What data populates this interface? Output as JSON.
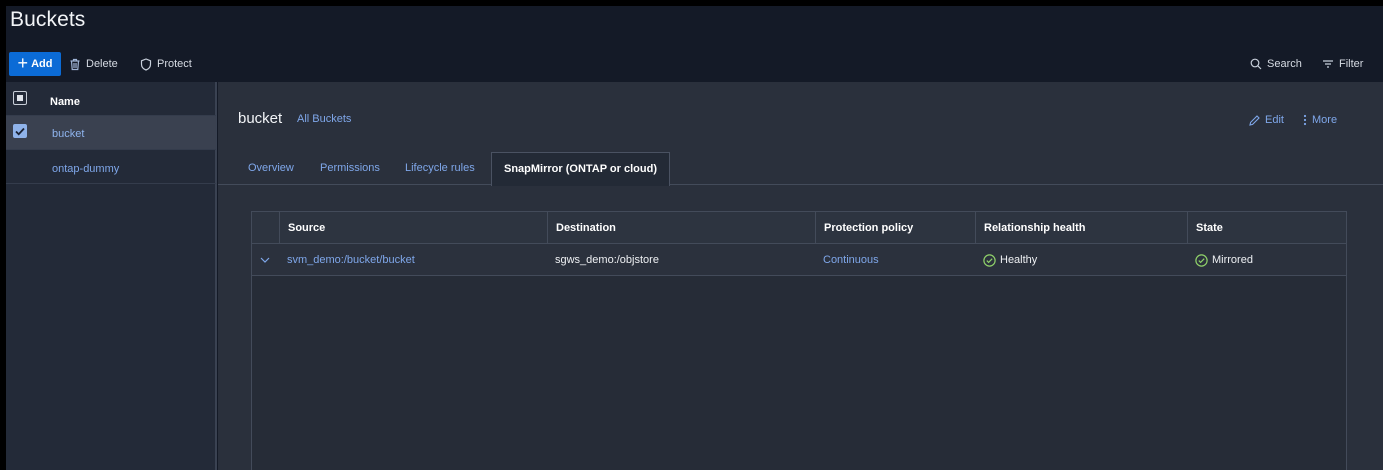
{
  "page": {
    "title": "Buckets"
  },
  "toolbar": {
    "add_label": "Add",
    "delete_label": "Delete",
    "protect_label": "Protect",
    "search_label": "Search",
    "filter_label": "Filter"
  },
  "list": {
    "header": "Name",
    "items": [
      {
        "label": "bucket",
        "selected": true
      },
      {
        "label": "ontap-dummy",
        "selected": false
      }
    ]
  },
  "detail": {
    "title": "bucket",
    "all_buckets_link": "All Buckets",
    "edit_label": "Edit",
    "more_label": "More",
    "tabs": [
      {
        "label": "Overview"
      },
      {
        "label": "Permissions"
      },
      {
        "label": "Lifecycle rules"
      },
      {
        "label": "SnapMirror (ONTAP or cloud)",
        "active": true
      }
    ]
  },
  "table": {
    "columns": [
      "Source",
      "Destination",
      "Protection policy",
      "Relationship health",
      "State"
    ],
    "rows": [
      {
        "source": "svm_demo:/bucket/bucket",
        "destination": "sgws_demo:/objstore",
        "policy": "Continuous",
        "health": "Healthy",
        "state": "Mirrored"
      }
    ]
  },
  "colors": {
    "accent": "#0b6bd6",
    "link": "#7fa7ea",
    "status_ok": "#8fd16a",
    "background": "#141a27",
    "panel": "#2a303c"
  }
}
